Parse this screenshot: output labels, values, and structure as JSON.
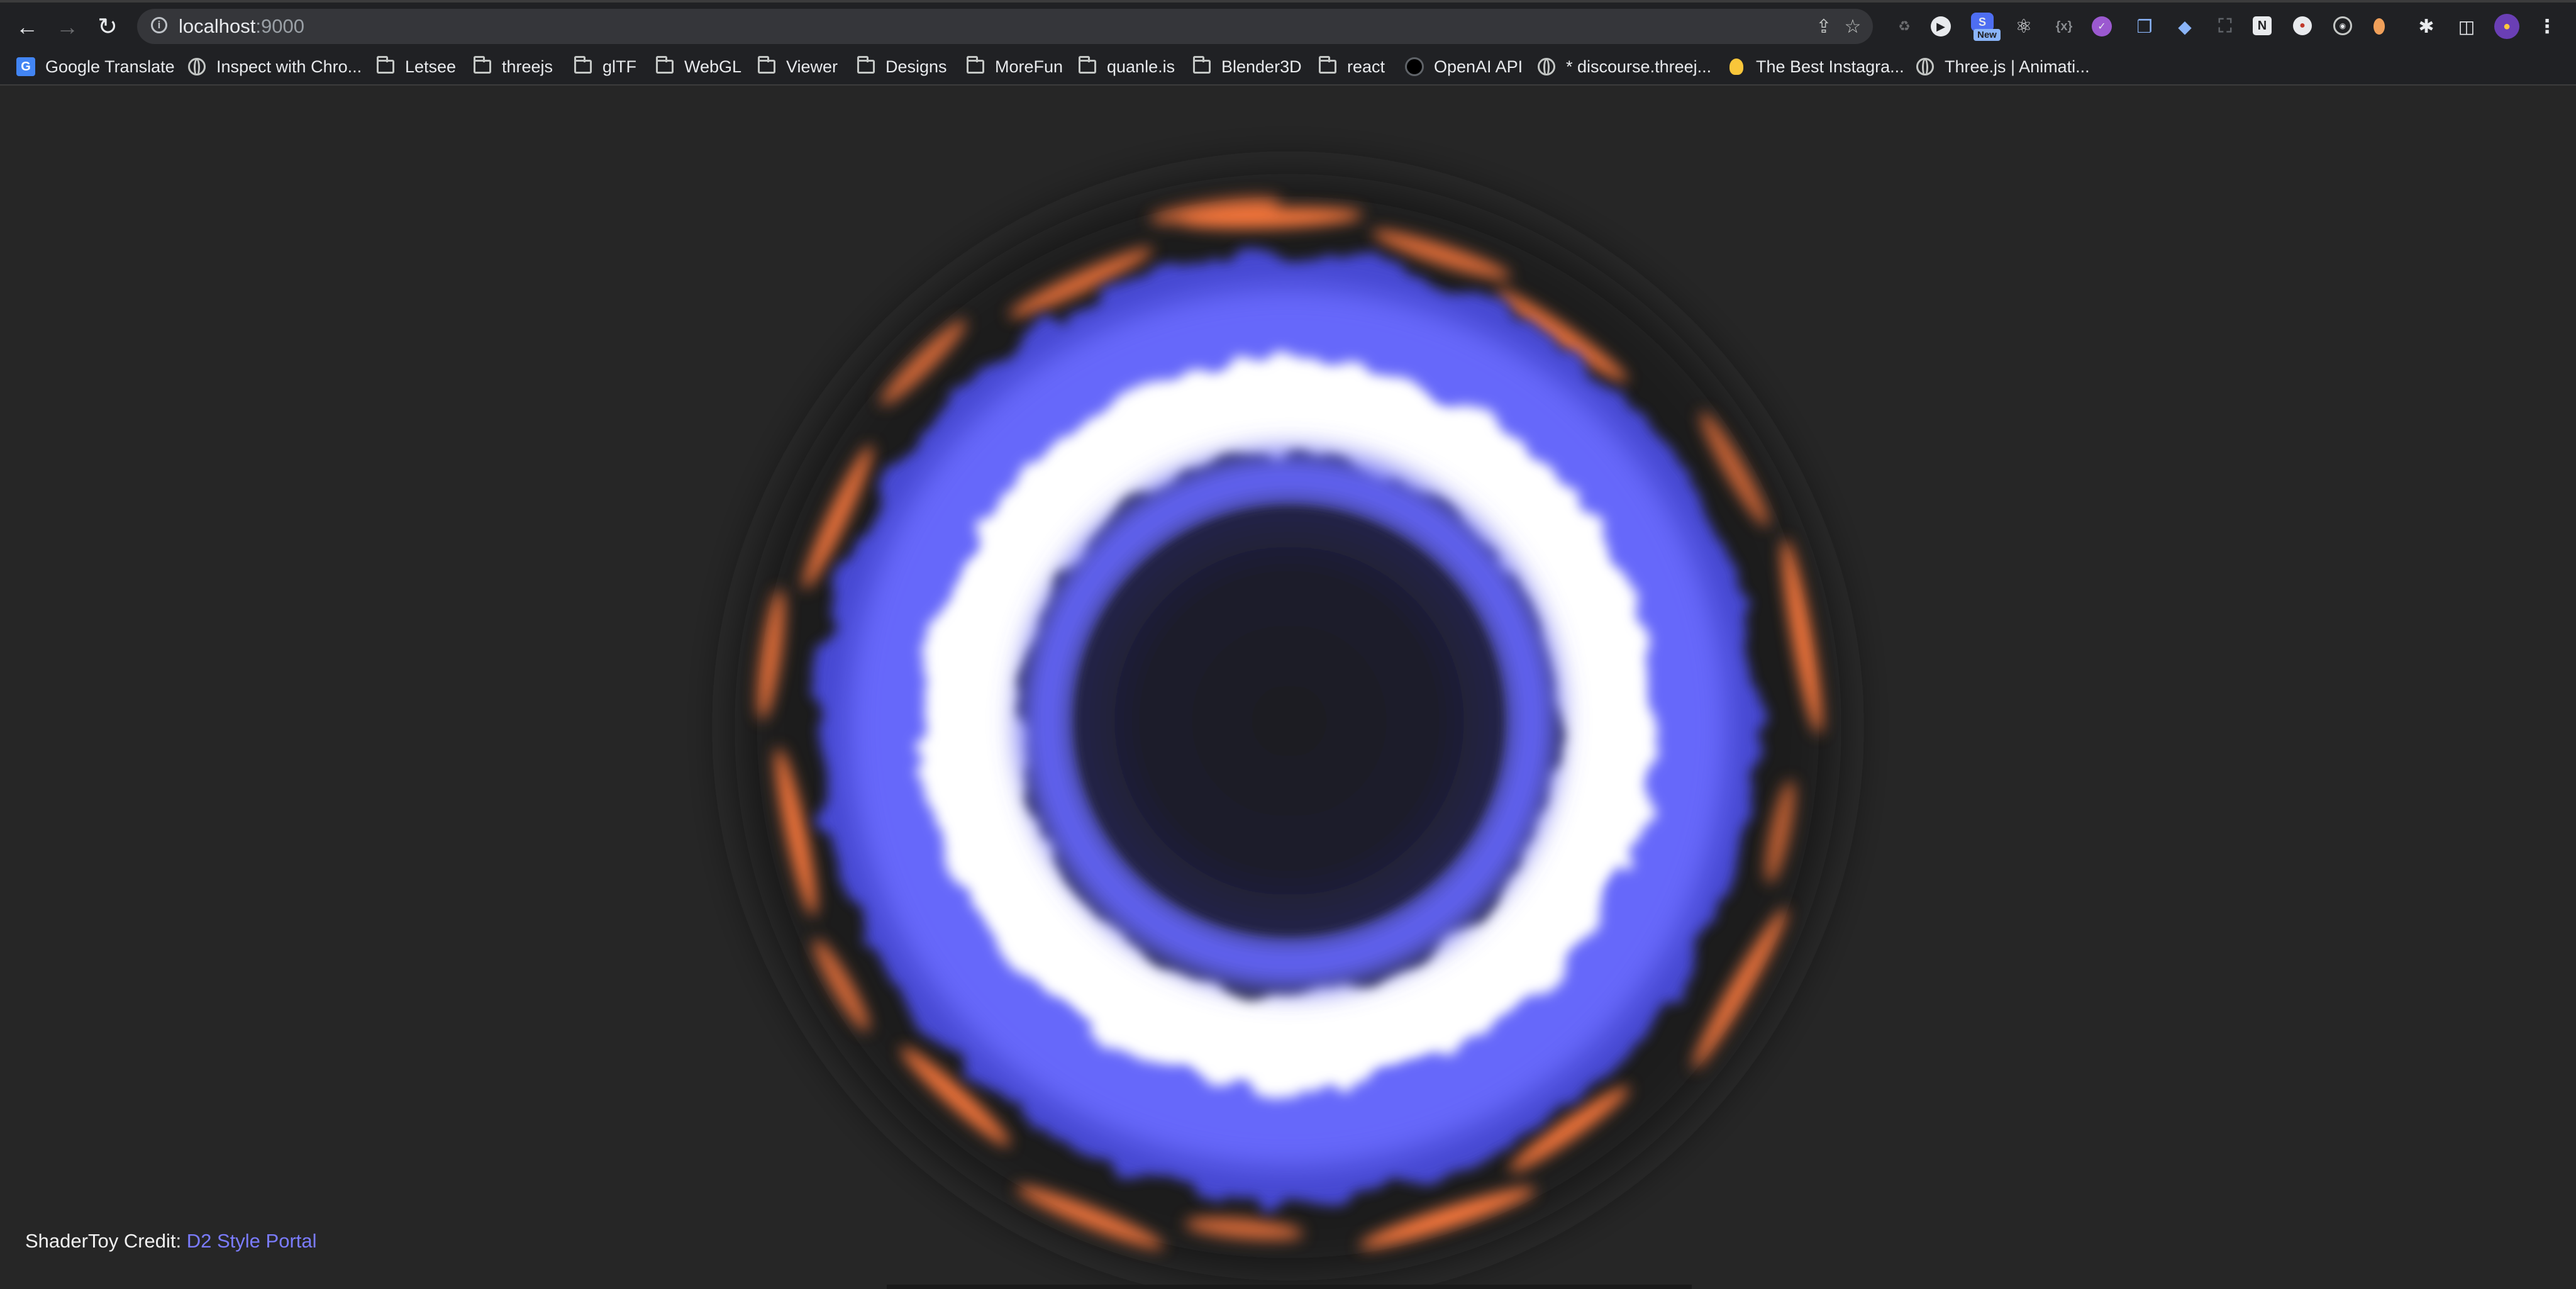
{
  "browser": {
    "url_host": "localhost",
    "url_port": ":9000",
    "new_badge": "New"
  },
  "bookmarks": [
    {
      "label": "Google Translate",
      "icon": "google-translate-icon"
    },
    {
      "label": "Inspect with Chro...",
      "icon": "globe-icon"
    },
    {
      "label": "Letsee",
      "icon": "folder-icon"
    },
    {
      "label": "threejs",
      "icon": "folder-icon"
    },
    {
      "label": "glTF",
      "icon": "folder-icon"
    },
    {
      "label": "WebGL",
      "icon": "folder-icon"
    },
    {
      "label": "Viewer",
      "icon": "folder-icon"
    },
    {
      "label": "Designs",
      "icon": "folder-icon"
    },
    {
      "label": "MoreFun",
      "icon": "folder-icon"
    },
    {
      "label": "quanle.is",
      "icon": "folder-icon"
    },
    {
      "label": "Blender3D",
      "icon": "folder-icon"
    },
    {
      "label": "react",
      "icon": "folder-icon"
    },
    {
      "label": "OpenAI API",
      "icon": "openai-icon"
    },
    {
      "label": "* discourse.threej...",
      "icon": "globe-icon"
    },
    {
      "label": "The Best Instagra...",
      "icon": "lightbulb-icon"
    },
    {
      "label": "Three.js | Animati...",
      "icon": "globe-icon"
    }
  ],
  "page": {
    "credit_prefix": "ShaderToy Credit:",
    "credit_link": "D2 Style Portal"
  },
  "colors": {
    "background": "#262626",
    "portal_core": "#ffffff",
    "portal_glow": "#5a5cff",
    "flame": "#ff7a3d",
    "link": "#7b7cff"
  }
}
